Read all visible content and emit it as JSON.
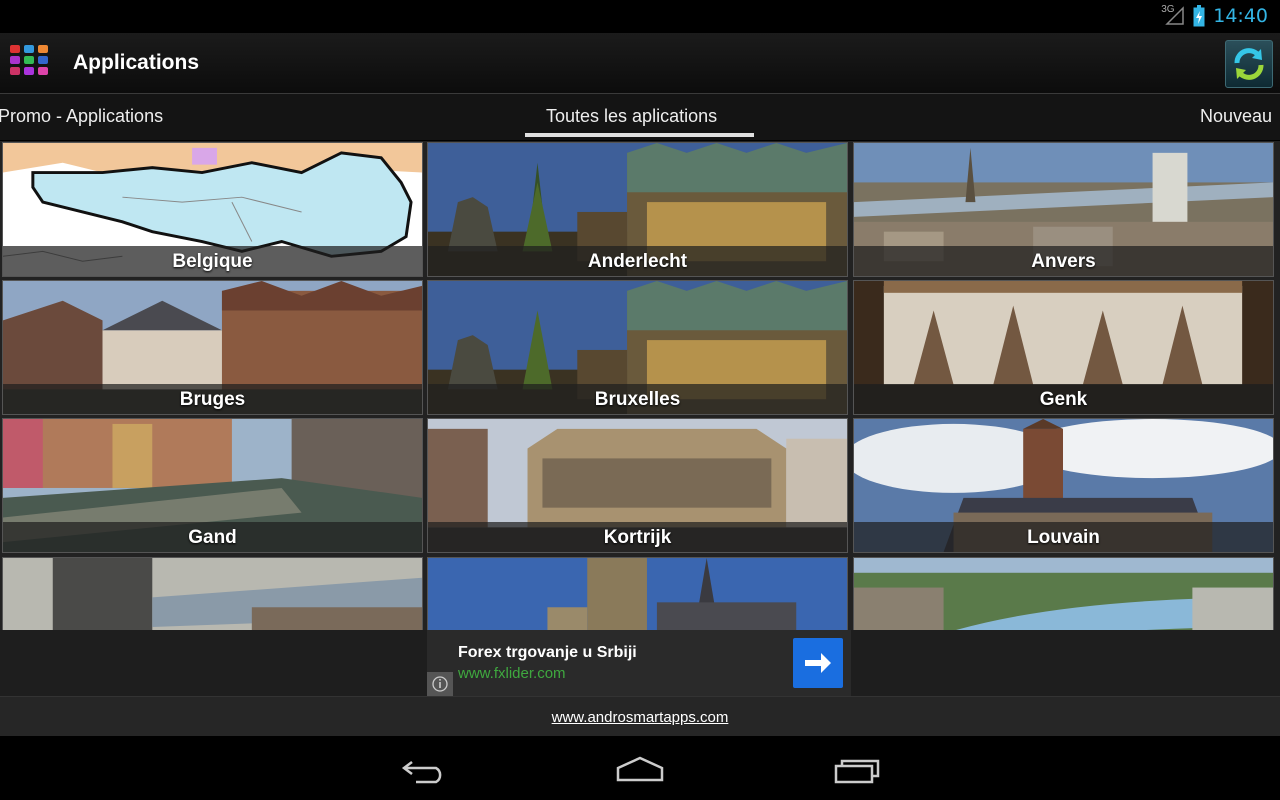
{
  "status": {
    "network": "3G",
    "time": "14:40"
  },
  "header": {
    "title": "Applications"
  },
  "tabs": [
    {
      "label": "Promo - Applications"
    },
    {
      "label": "Toutes les aplications"
    },
    {
      "label": "Nouveau"
    }
  ],
  "tiles": [
    {
      "label": "Belgique"
    },
    {
      "label": "Anderlecht"
    },
    {
      "label": "Anvers"
    },
    {
      "label": "Bruges"
    },
    {
      "label": "Bruxelles"
    },
    {
      "label": "Genk"
    },
    {
      "label": "Gand"
    },
    {
      "label": "Kortrijk"
    },
    {
      "label": "Louvain"
    },
    {
      "label": ""
    },
    {
      "label": ""
    },
    {
      "label": ""
    }
  ],
  "ad": {
    "title": "Forex trgovanje u Srbiji",
    "url": "www.fxlider.com",
    "info_icon": "info-icon",
    "arrow_icon": "arrow-right-icon"
  },
  "footer": {
    "link": "www.androsmartapps.com"
  },
  "nav": {
    "back_icon": "back-icon",
    "home_icon": "home-icon",
    "recents_icon": "recents-icon"
  },
  "colors": {
    "accent": "#33b5e5",
    "ad_button": "#1a6ee0",
    "ad_url": "#3fa83f"
  }
}
